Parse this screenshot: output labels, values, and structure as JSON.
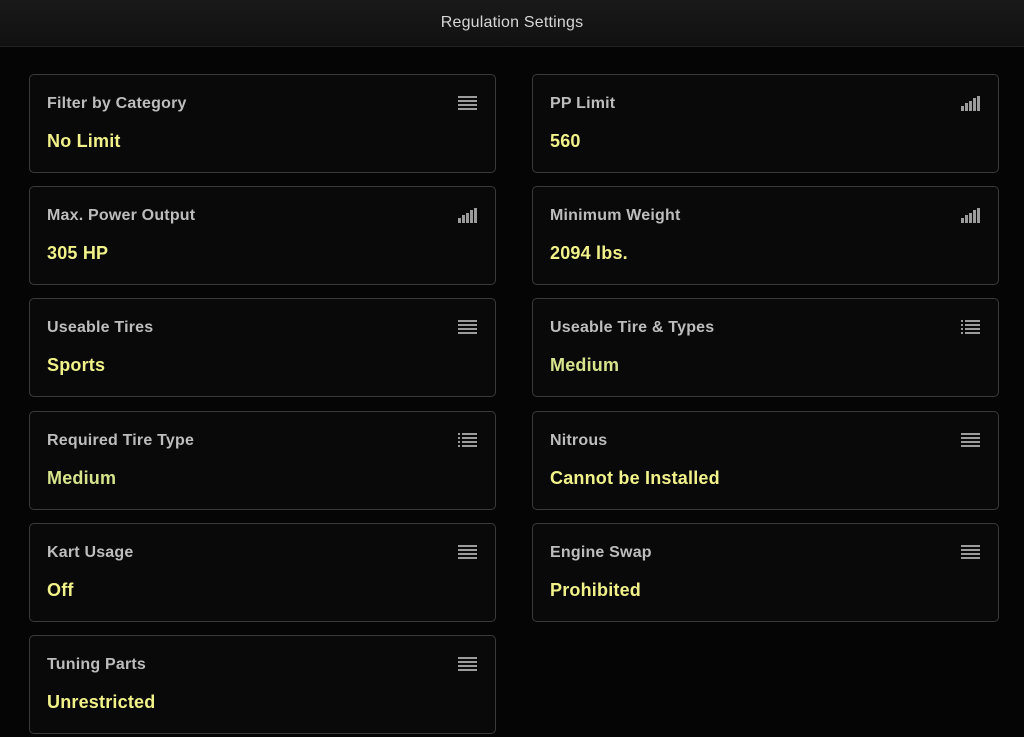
{
  "header": {
    "title": "Regulation Settings"
  },
  "colors": {
    "background": "#050505",
    "card_border": "#3a3a3a",
    "label": "#bdbdbd",
    "value": "#f2f28a",
    "value_muted": "#d7e48c",
    "icon": "#9c9c9c"
  },
  "settings": [
    {
      "label": "Filter by Category",
      "value": "No Limit",
      "icon": "menu-icon"
    },
    {
      "label": "PP Limit",
      "value": "560",
      "icon": "signal-bars-icon"
    },
    {
      "label": "Max. Power Output",
      "value": "305 HP",
      "icon": "signal-bars-icon"
    },
    {
      "label": "Minimum Weight",
      "value": "2094 lbs.",
      "icon": "signal-bars-icon"
    },
    {
      "label": "Useable Tires",
      "value": "Sports",
      "icon": "menu-icon"
    },
    {
      "label": "Useable Tire & Types",
      "value": "Medium",
      "icon": "list-icon"
    },
    {
      "label": "Required Tire Type",
      "value": "Medium",
      "icon": "list-icon"
    },
    {
      "label": "Nitrous",
      "value": "Cannot be Installed",
      "icon": "menu-icon"
    },
    {
      "label": "Kart Usage",
      "value": "Off",
      "icon": "menu-icon"
    },
    {
      "label": "Engine Swap",
      "value": "Prohibited",
      "icon": "menu-icon"
    },
    {
      "label": "Tuning Parts",
      "value": "Unrestricted",
      "icon": "menu-icon"
    }
  ]
}
